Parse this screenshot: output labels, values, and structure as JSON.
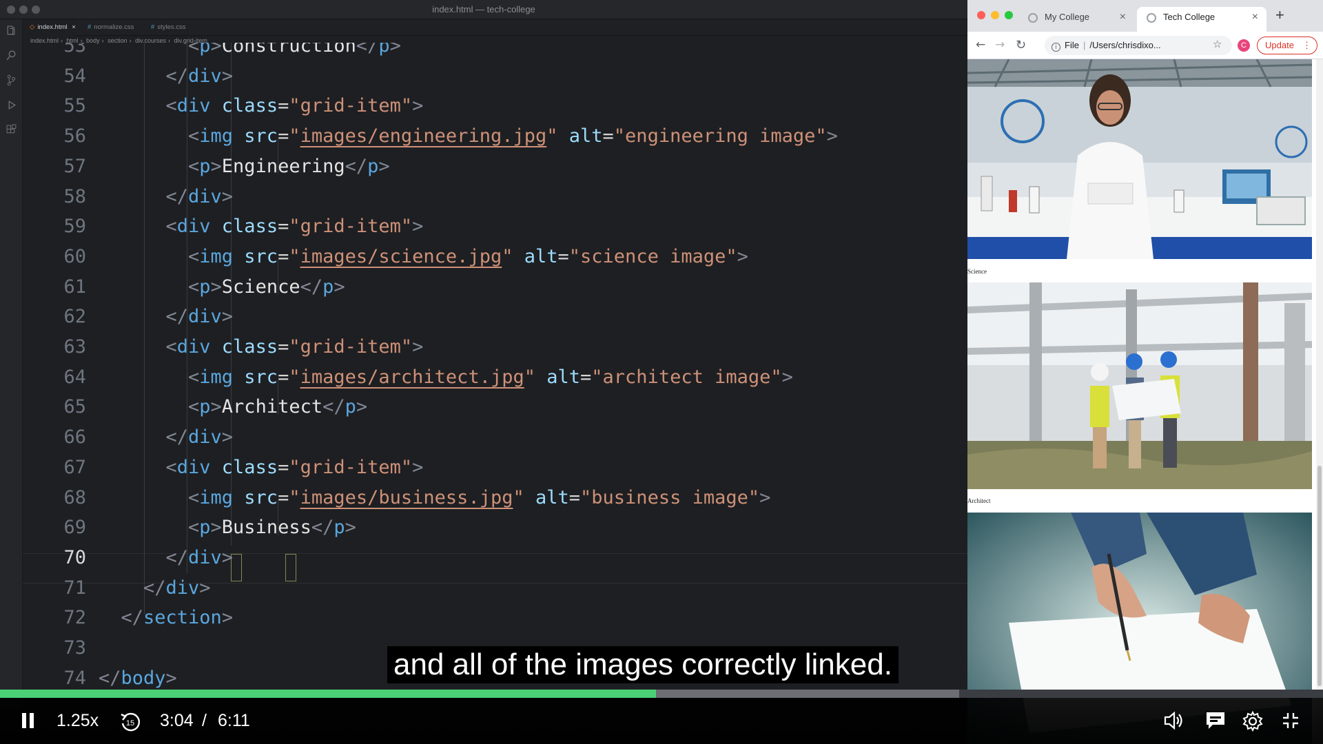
{
  "editor": {
    "window_title": "index.html — tech-college",
    "tabs": [
      {
        "label": "index.html",
        "close": "×"
      },
      {
        "label": "normalize.css"
      },
      {
        "label": "styles.css"
      }
    ],
    "breadcrumb": [
      "index.html",
      "html",
      "body",
      "section",
      "div.courses",
      "div.grid-item"
    ],
    "current_line": "70"
  },
  "browser": {
    "tabs": [
      {
        "label": "My College",
        "close": "×"
      },
      {
        "label": "Tech College",
        "close": "×"
      }
    ],
    "new_tab": "+",
    "address": {
      "scheme": "File",
      "path": "/Users/chrisdixo..."
    },
    "profile_initial": "C",
    "update_label": "Update",
    "captions": [
      "Science",
      "Architect"
    ]
  },
  "player": {
    "subtitle": "and all of the images correctly linked.",
    "speed": "1.25x",
    "skip_back": "15",
    "current_time": "3:04",
    "separator": "/",
    "duration": "6:11",
    "progress": 0.496,
    "buffered": 0.725
  },
  "colors": {
    "progress_played": "#4ad176",
    "tag": "#5aa7e0",
    "attribute": "#9cdcfe",
    "string": "#ce9178"
  },
  "icons": [
    "pause-icon",
    "replay-15-icon",
    "volume-icon",
    "captions-icon",
    "settings-icon",
    "exit-fullscreen-icon",
    "back-arrow-icon",
    "forward-arrow-icon",
    "reload-icon",
    "star-icon",
    "extensions-icon"
  ]
}
